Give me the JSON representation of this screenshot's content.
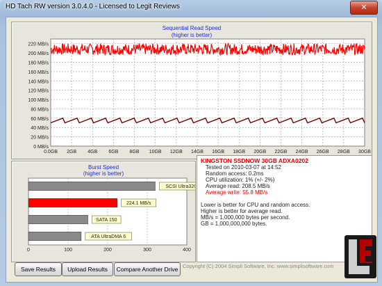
{
  "window": {
    "title": "HD Tach RW version 3.0.4.0 - Licensed to Legit Reviews",
    "close_glyph": "✕"
  },
  "read_chart": {
    "title": "Sequential Read Speed",
    "subtitle": "(higher is better)",
    "y_ticks": [
      "0 MB/s",
      "20 MB/s",
      "40 MB/s",
      "60 MB/s",
      "80 MB/s",
      "100 MB/s",
      "120 MB/s",
      "140 MB/s",
      "160 MB/s",
      "180 MB/s",
      "200 MB/s",
      "220 MB/s"
    ],
    "x_ticks": [
      "0.0GB",
      "2GB",
      "4GB",
      "6GB",
      "8GB",
      "10GB",
      "12GB",
      "14GB",
      "16GB",
      "18GB",
      "20GB",
      "22GB",
      "24GB",
      "26GB",
      "28GB",
      "30GB"
    ],
    "read_color": "#ff0000",
    "write_color": "#7a0000"
  },
  "chart_data": [
    {
      "type": "line",
      "title": "Sequential Read Speed",
      "subtitle": "(higher is better)",
      "xlabel": "",
      "ylabel": "",
      "xlim": [
        0,
        30
      ],
      "ylim": [
        0,
        230
      ],
      "x_unit": "GB",
      "y_unit": "MB/s",
      "grid": true,
      "series": [
        {
          "name": "",
          "color": "#ff0000",
          "approx_mean": 208,
          "approx_range": [
            196,
            220
          ]
        },
        {
          "name": "",
          "color": "#7a0000",
          "approx_range": [
            50,
            60
          ],
          "pattern": "sawtooth"
        }
      ]
    },
    {
      "type": "bar",
      "title": "Burst Speed",
      "subtitle": "(higher is better)",
      "xlim": [
        0,
        400
      ],
      "x_ticks": [
        "0",
        "100",
        "200",
        "300",
        "400"
      ],
      "categories": [
        "SCSI Ultra320",
        "KINGSTON SSDNOW 30GB",
        "SATA 150",
        "ATA UltraDMA 6"
      ],
      "values": [
        320,
        224.1,
        150,
        133
      ],
      "value_labels": [
        "SCSI Ultra320",
        "224.1 MB/s",
        "SATA 150",
        "ATA UltraDMA 6"
      ],
      "colors": [
        "#8a8a8a",
        "#ff0000",
        "#8a8a8a",
        "#8a8a8a"
      ]
    }
  ],
  "burst_chart": {
    "title": "Burst Speed",
    "subtitle": "(higher is better)"
  },
  "info": {
    "drive_name": "KINGSTON SSDNOW 30GB ADXA0202",
    "tested_on": "Tested on 2010-03-07 at 14:52",
    "random_access": "Random access: 0.2ms",
    "cpu": "CPU utilization: 1% (+/- 2%)",
    "avg_read": "Average read: 208.5 MB/s",
    "avg_write": "Average write: 55.8 MB/s",
    "note1": "Lower is better for CPU and random access.",
    "note2": "Higher is better for average read.",
    "note3": "MB/s = 1,000,000 bytes per second.",
    "note4": "GB = 1,000,000,000 bytes."
  },
  "buttons": {
    "save": "Save Results",
    "upload": "Upload Results",
    "compare": "Compare Another Drive"
  },
  "footer": {
    "copyright": "Copyright (C) 2004 Simpli Software, Inc. www.simplisoftware.com"
  },
  "logo": {
    "letters": "LEGITREVIEWS",
    "text": "LEGIT REVIEWS"
  }
}
